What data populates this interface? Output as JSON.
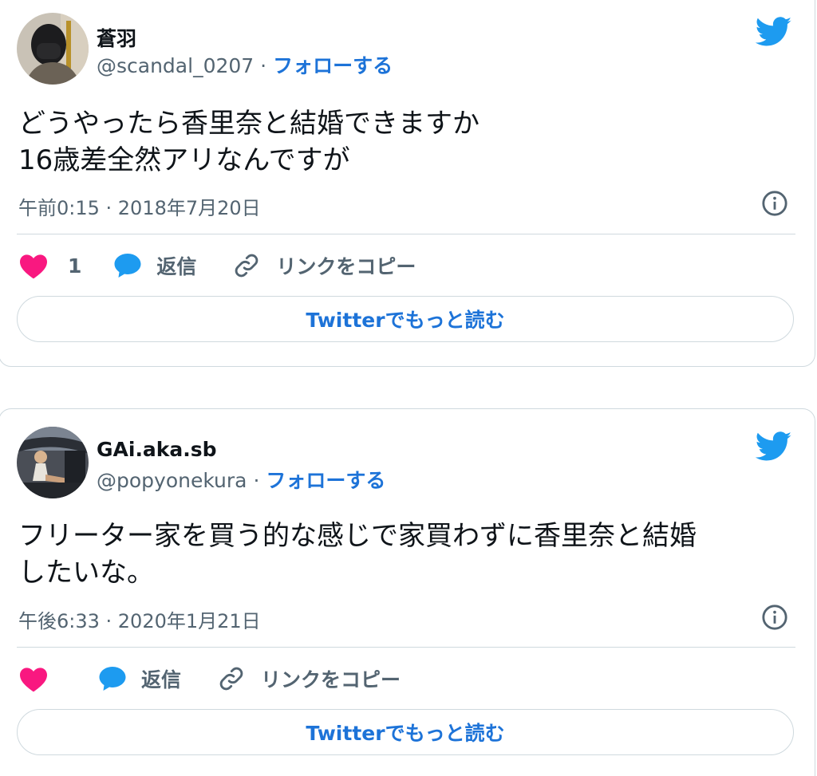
{
  "tweets": [
    {
      "display_name": "蒼羽",
      "handle": "@scandal_0207",
      "separator": "·",
      "follow_label": "フォローする",
      "text": "どうやったら香里奈と結婚できますか\n16歳差全然アリなんですが",
      "timestamp": "午前0:15 · 2018年7月20日",
      "like_count": "1",
      "reply_label": "返信",
      "copy_link_label": "リンクをコピー",
      "read_more_label": "Twitterでもっと読む"
    },
    {
      "display_name": "GAi.aka.sb",
      "handle": "@popyonekura",
      "separator": "·",
      "follow_label": "フォローする",
      "text": "フリーター家を買う的な感じで家買わずに香里奈と結婚\nしたいな。",
      "timestamp": "午後6:33 · 2020年1月21日",
      "like_count": "",
      "reply_label": "返信",
      "copy_link_label": "リンクをコピー",
      "read_more_label": "Twitterでもっと読む"
    }
  ],
  "icons": {
    "brand": "twitter-bird-icon",
    "info": "info-icon",
    "like": "heart-icon",
    "reply": "speech-bubble-icon",
    "link": "link-icon"
  },
  "colors": {
    "twitter_blue": "#1d9bf0",
    "link_blue": "#1d73d8",
    "heart_pink": "#f91880",
    "secondary_text": "#536471",
    "border": "#cfd9de"
  }
}
